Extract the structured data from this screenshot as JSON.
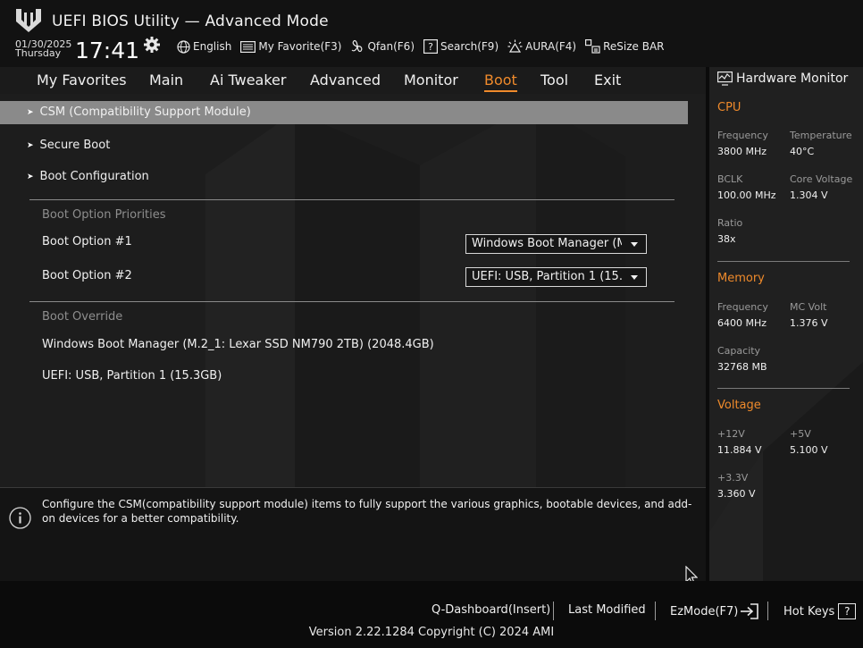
{
  "header": {
    "title": "UEFI BIOS Utility — Advanced Mode",
    "date": "01/30/2025",
    "day": "Thursday",
    "time": "17:41",
    "toolbar": {
      "language": "English",
      "favorite": "My Favorite(F3)",
      "qfan": "Qfan(F6)",
      "search": "Search(F9)",
      "aura": "AURA(F4)",
      "resize_bar": "ReSize BAR"
    }
  },
  "nav": {
    "tabs": [
      "My Favorites",
      "Main",
      "Ai Tweaker",
      "Advanced",
      "Monitor",
      "Boot",
      "Tool",
      "Exit"
    ],
    "active": "Boot"
  },
  "main": {
    "menu": [
      "CSM (Compatibility Support Module)",
      "Secure Boot",
      "Boot Configuration"
    ],
    "boot_priorities": {
      "label": "Boot Option Priorities",
      "option1_label": "Boot Option #1",
      "option1_value": "Windows Boot Manager (M.2_1: Lexar SSD NM790 2TB)",
      "option2_label": "Boot Option #2",
      "option2_value": "UEFI:  USB, Partition 1 (15.3GB)"
    },
    "boot_override": {
      "label": "Boot Override",
      "items": [
        "Windows Boot Manager (M.2_1: Lexar SSD NM790 2TB) (2048.4GB)",
        "UEFI:  USB, Partition 1 (15.3GB)"
      ]
    }
  },
  "info": {
    "text": "Configure the CSM(compatibility support module) items to fully support the various graphics, bootable devices, and add-on devices for a better compatibility."
  },
  "hardware_monitor": {
    "title": "Hardware Monitor",
    "cpu": {
      "label": "CPU",
      "frequency_label": "Frequency",
      "frequency": "3800 MHz",
      "temperature_label": "Temperature",
      "temperature": "40°C",
      "bclk_label": "BCLK",
      "bclk": "100.00 MHz",
      "core_voltage_label": "Core Voltage",
      "core_voltage": "1.304 V",
      "ratio_label": "Ratio",
      "ratio": "38x"
    },
    "memory": {
      "label": "Memory",
      "frequency_label": "Frequency",
      "frequency": "6400 MHz",
      "mc_volt_label": "MC Volt",
      "mc_volt": "1.376 V",
      "capacity_label": "Capacity",
      "capacity": "32768 MB"
    },
    "voltage": {
      "label": "Voltage",
      "v12_label": "+12V",
      "v12": "11.884 V",
      "v5_label": "+5V",
      "v5": "5.100 V",
      "v33_label": "+3.3V",
      "v33": "3.360 V"
    }
  },
  "footer": {
    "q_dashboard": "Q-Dashboard(Insert)",
    "last_modified": "Last Modified",
    "ezmode": "EzMode(F7)",
    "hot_keys": "Hot Keys",
    "hot_keys_icon": "?",
    "version": "Version 2.22.1284 Copyright (C) 2024 AMI"
  },
  "colors": {
    "accent": "#ef8a2b",
    "highlight_row": "#8a8a8a",
    "background": "#1d1d1d"
  },
  "icons": [
    "tuf-logo-icon",
    "gear-icon",
    "globe-icon",
    "favorite-icon",
    "fan-icon",
    "search-icon",
    "aura-icon",
    "resize-bar-icon",
    "monitor-icon",
    "info-icon",
    "exit-arrow-icon",
    "mouse-cursor-icon"
  ]
}
